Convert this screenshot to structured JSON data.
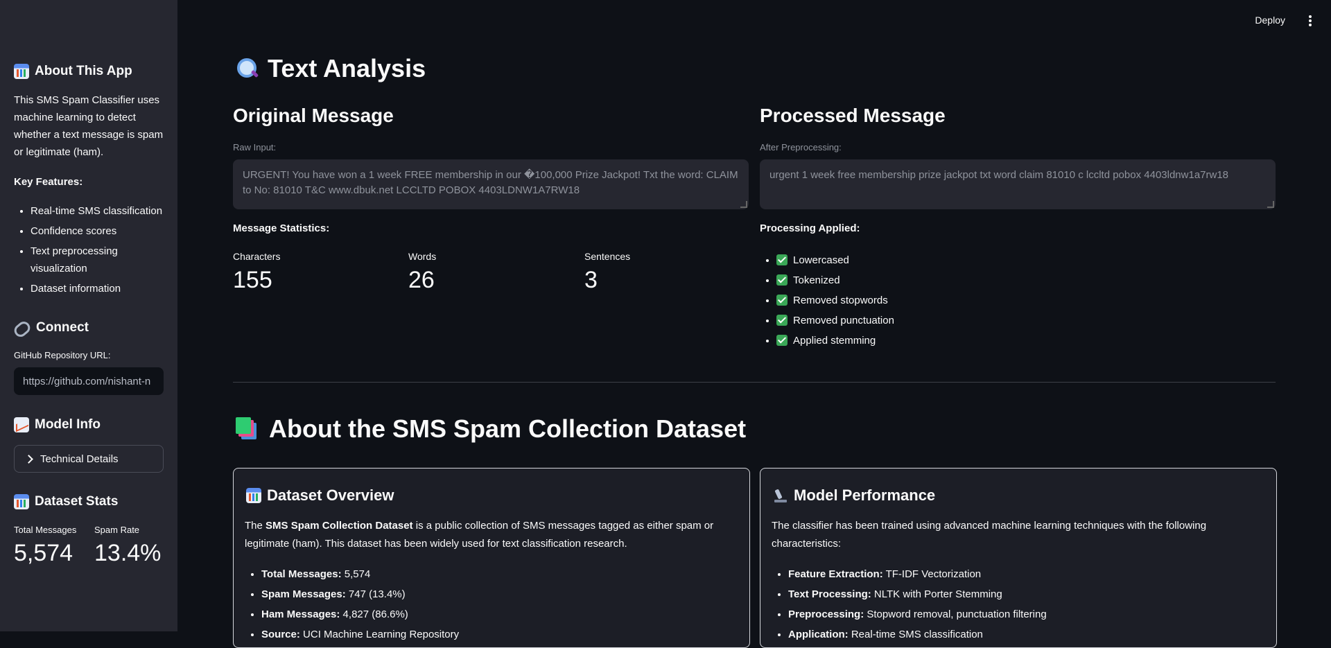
{
  "sidebar": {
    "about": {
      "title": "About This App",
      "description": "This SMS Spam Classifier uses machine learning to detect whether a text message is spam or legitimate (ham).",
      "features_label": "Key Features:",
      "features": [
        "Real-time SMS classification",
        "Confidence scores",
        "Text preprocessing visualization",
        "Dataset information"
      ]
    },
    "connect": {
      "title": "Connect",
      "github_label": "GitHub Repository URL:",
      "github_value": "https://github.com/nishant-n"
    },
    "model_info": {
      "title": "Model Info",
      "expander_label": "Technical Details"
    },
    "dataset_stats": {
      "title": "Dataset Stats",
      "total_label": "Total Messages",
      "total_value": "5,574",
      "spam_label": "Spam Rate",
      "spam_value": "13.4%"
    }
  },
  "toolbar": {
    "deploy_label": "Deploy"
  },
  "analysis": {
    "title": "Text Analysis",
    "original": {
      "title": "Original Message",
      "input_label": "Raw Input:",
      "text": "URGENT! You have won a 1 week FREE membership in our �100,000 Prize Jackpot! Txt the word: CLAIM to No: 81010 T&C www.dbuk.net LCCLTD POBOX 4403LDNW1A7RW18",
      "stats_label": "Message Statistics:",
      "stats": [
        {
          "label": "Characters",
          "value": "155"
        },
        {
          "label": "Words",
          "value": "26"
        },
        {
          "label": "Sentences",
          "value": "3"
        }
      ]
    },
    "processed": {
      "title": "Processed Message",
      "input_label": "After Preprocessing:",
      "text": "urgent 1 week free membership prize jackpot txt word claim 81010 c lccltd pobox 4403ldnw1a7rw18",
      "applied_label": "Processing Applied:",
      "steps": [
        "Lowercased",
        "Tokenized",
        "Removed stopwords",
        "Removed punctuation",
        "Applied stemming"
      ]
    }
  },
  "dataset": {
    "title": "About the SMS Spam Collection Dataset",
    "overview": {
      "title": "Dataset Overview",
      "intro_prefix": "The ",
      "intro_bold": "SMS Spam Collection Dataset",
      "intro_rest": " is a public collection of SMS messages tagged as either spam or legitimate (ham). This dataset has been widely used for text classification research.",
      "items": [
        {
          "key": "Total Messages:",
          "value": " 5,574"
        },
        {
          "key": "Spam Messages:",
          "value": " 747 (13.4%)"
        },
        {
          "key": "Ham Messages:",
          "value": " 4,827 (86.6%)"
        },
        {
          "key": "Source:",
          "value": " UCI Machine Learning Repository"
        }
      ]
    },
    "performance": {
      "title": "Model Performance",
      "intro": "The classifier has been trained using advanced machine learning techniques with the following characteristics:",
      "items": [
        {
          "key": "Feature Extraction:",
          "value": " TF-IDF Vectorization"
        },
        {
          "key": "Text Processing:",
          "value": " NLTK with Porter Stemming"
        },
        {
          "key": "Preprocessing:",
          "value": " Stopword removal, punctuation filtering"
        },
        {
          "key": "Application:",
          "value": " Real-time SMS classification"
        }
      ]
    }
  }
}
